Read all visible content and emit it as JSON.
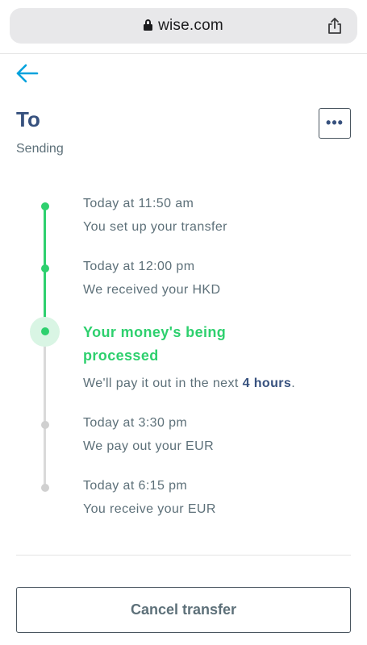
{
  "browser": {
    "url": "wise.com"
  },
  "header": {
    "title": "To",
    "status": "Sending",
    "more_label": "•••"
  },
  "timeline": {
    "steps": [
      {
        "time": "Today at 11:50 am",
        "description": "You set up your transfer",
        "state": "done"
      },
      {
        "time": "Today at 12:00 pm",
        "description": "We received your HKD",
        "state": "done"
      },
      {
        "title": "Your money's being processed",
        "description_prefix": "We'll pay it out in the next",
        "description_highlight": "4 hours",
        "description_suffix": ".",
        "state": "current"
      },
      {
        "time": "Today at 3:30 pm",
        "description": "We pay out your EUR",
        "state": "pending"
      },
      {
        "time": "Today at 6:15 pm",
        "description": "You receive your EUR",
        "state": "pending"
      }
    ]
  },
  "actions": {
    "cancel_label": "Cancel transfer"
  },
  "colors": {
    "accent_green": "#2ed06e",
    "link_blue": "#00a2dd",
    "heading_navy": "#37517e",
    "pending_gray": "#d0d0d0"
  }
}
